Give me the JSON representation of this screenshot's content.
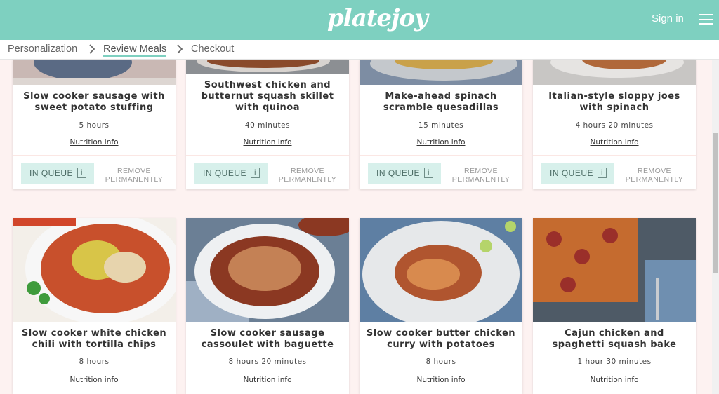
{
  "header": {
    "logo": "platejoy",
    "sign_in": "Sign in",
    "menu_icon": "hamburger-menu-icon"
  },
  "breadcrumb": {
    "items": [
      "Personalization",
      "Review Meals",
      "Checkout"
    ],
    "active": "Review Meals"
  },
  "colors": {
    "brand": "#7ed0c0",
    "page_bg": "#fdf2f1",
    "queue_btn": "#d7f0eb"
  },
  "meals_row1": [
    {
      "title": "Slow cooker sausage with sweet potato stuffing",
      "time": "5 hours",
      "nutrition": "Nutrition info",
      "queue": "IN QUEUE",
      "info": "i",
      "remove": "REMOVE PERMANENTLY"
    },
    {
      "title": "Southwest chicken and butternut squash skillet with quinoa",
      "time": "40 minutes",
      "nutrition": "Nutrition info",
      "queue": "IN QUEUE",
      "info": "i",
      "remove": "REMOVE PERMANENTLY"
    },
    {
      "title": "Make-ahead spinach scramble quesadillas",
      "time": "15 minutes",
      "nutrition": "Nutrition info",
      "queue": "IN QUEUE",
      "info": "i",
      "remove": "REMOVE PERMANENTLY"
    },
    {
      "title": "Italian-style sloppy joes with spinach",
      "time": "4 hours 20 minutes",
      "nutrition": "Nutrition info",
      "queue": "IN QUEUE",
      "info": "i",
      "remove": "REMOVE PERMANENTLY"
    }
  ],
  "meals_row2": [
    {
      "title": "Slow cooker white chicken chili with tortilla chips",
      "time": "8 hours",
      "nutrition": "Nutrition info"
    },
    {
      "title": "Slow cooker sausage cassoulet with baguette",
      "time": "8 hours 20 minutes",
      "nutrition": "Nutrition info"
    },
    {
      "title": "Slow cooker butter chicken curry with potatoes",
      "time": "8 hours",
      "nutrition": "Nutrition info"
    },
    {
      "title": "Cajun chicken and spaghetti squash bake",
      "time": "1 hour 30 minutes",
      "nutrition": "Nutrition info"
    }
  ]
}
